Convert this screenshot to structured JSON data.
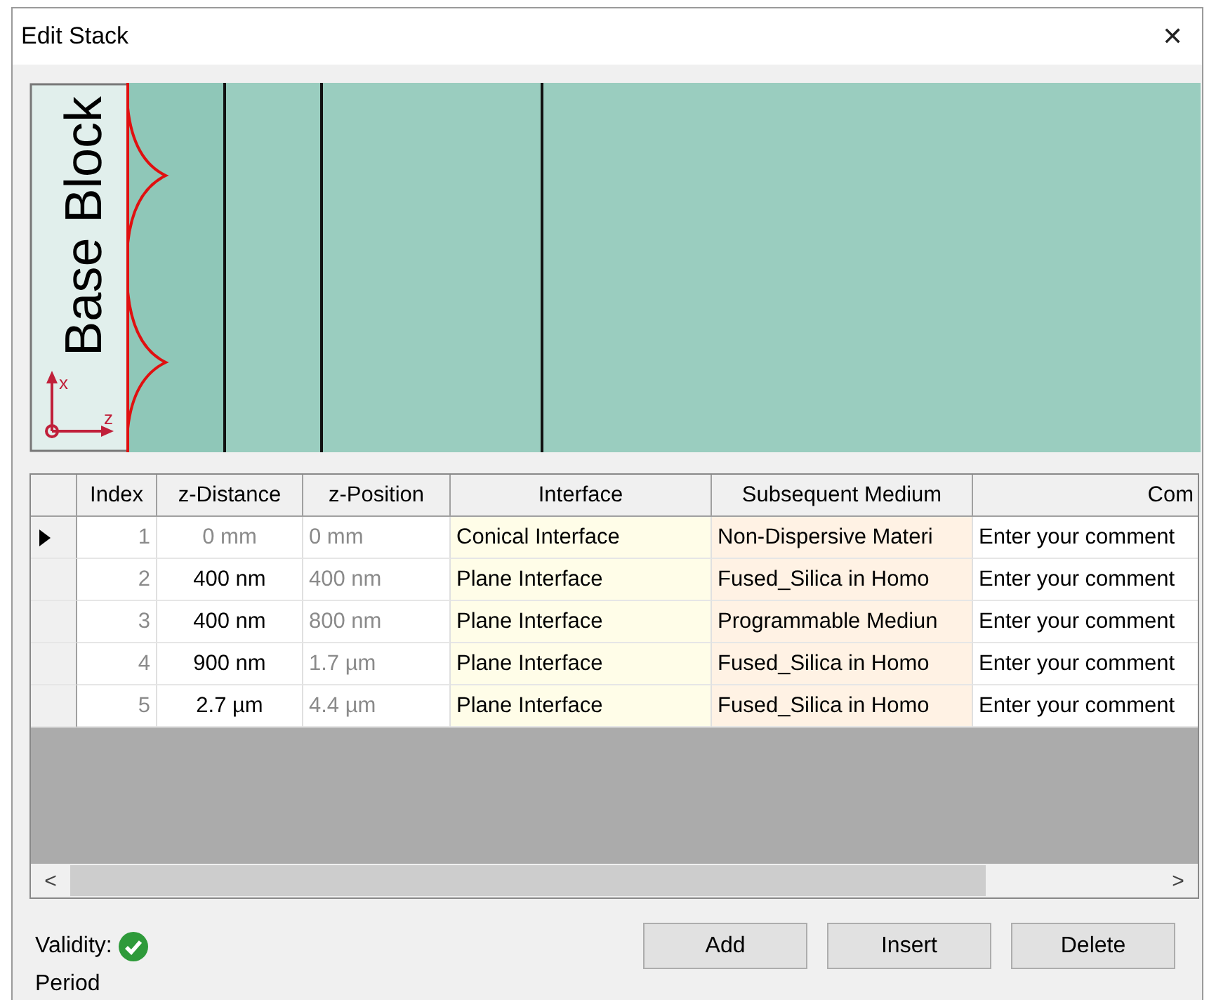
{
  "window": {
    "title": "Edit Stack",
    "close": "✕"
  },
  "preview": {
    "base_label": "Base Block",
    "axis_x": "x",
    "axis_z": "z"
  },
  "table": {
    "columns": [
      "Index",
      "z-Distance",
      "z-Position",
      "Interface",
      "Subsequent Medium",
      "Com"
    ],
    "rows": [
      {
        "selected": true,
        "index": "1",
        "z_distance": "0 mm",
        "z_distance_readonly": true,
        "z_position": "0 mm",
        "interface": "Conical Interface",
        "medium": "Non-Dispersive Materi",
        "comment": "Enter your comment"
      },
      {
        "selected": false,
        "index": "2",
        "z_distance": "400 nm",
        "z_distance_readonly": false,
        "z_position": "400 nm",
        "interface": "Plane Interface",
        "medium": "Fused_Silica in Homo",
        "comment": "Enter your comment"
      },
      {
        "selected": false,
        "index": "3",
        "z_distance": "400 nm",
        "z_distance_readonly": false,
        "z_position": "800 nm",
        "interface": "Plane Interface",
        "medium": "Programmable Mediun",
        "comment": "Enter your comment"
      },
      {
        "selected": false,
        "index": "4",
        "z_distance": "900 nm",
        "z_distance_readonly": false,
        "z_position": "1.7 µm",
        "interface": "Plane Interface",
        "medium": "Fused_Silica in Homo",
        "comment": "Enter your comment"
      },
      {
        "selected": false,
        "index": "5",
        "z_distance": "2.7 µm",
        "z_distance_readonly": false,
        "z_position": "4.4 µm",
        "interface": "Plane Interface",
        "medium": "Fused_Silica in Homo",
        "comment": "Enter your comment"
      }
    ],
    "scroll_left": "<",
    "scroll_right": ">"
  },
  "validity": {
    "label": "Validity:",
    "valid": true
  },
  "buttons": [
    "Add",
    "Insert",
    "Delete"
  ],
  "period_label": "Period"
}
